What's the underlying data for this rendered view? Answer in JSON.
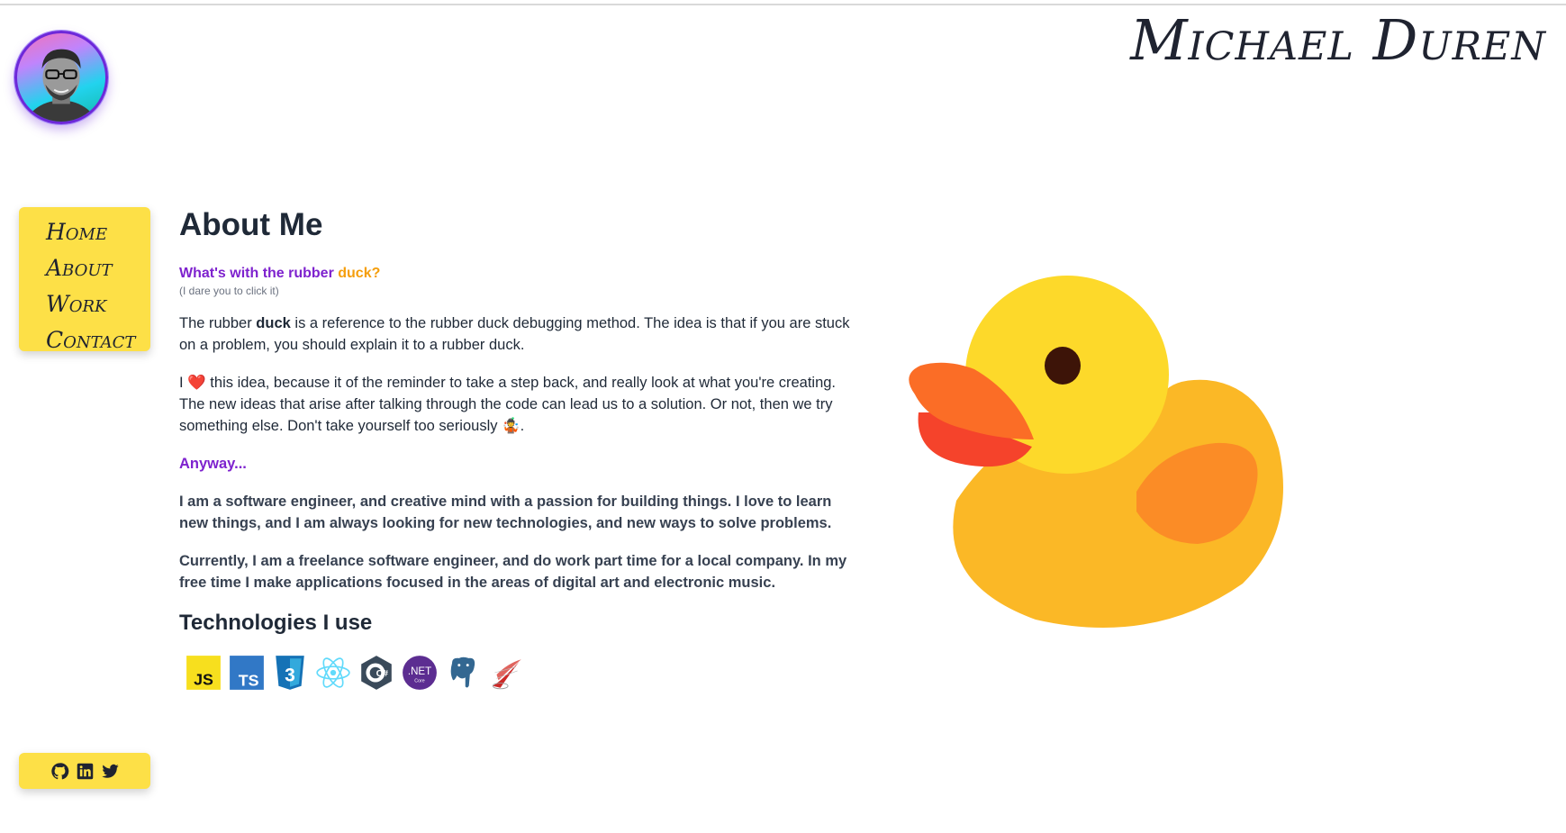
{
  "header": {
    "site_name": "Michael Duren",
    "avatar_icon": "avatar-photo-icon"
  },
  "nav": {
    "items": [
      {
        "label": "Home"
      },
      {
        "label": "About"
      },
      {
        "label": "Work"
      },
      {
        "label": "Contact"
      }
    ]
  },
  "main": {
    "title": "About Me",
    "duck_question_prefix": "What's with the rubber ",
    "duck_question_link": "duck?",
    "dare": "(I dare you to click it)",
    "para1_a": "The rubber ",
    "para1_b": "duck",
    "para1_c": " is a reference to the rubber duck debugging method. The idea is that if you are stuck on a problem, you should explain it to a rubber duck.",
    "para2_a": "I ",
    "para2_heart": "❤️",
    "para2_b": " this idea, because it of the reminder to take a step back, and really look at what you're creating. The new ideas that arise after talking through the code can lead us to a solution. Or not, then we try something else. Don't take yourself too seriously ",
    "para2_emoji": "🤹",
    "para2_end": ".",
    "anyway": "Anyway...",
    "para3": "I am a software engineer, and creative mind with a passion for building things. I love to learn new things, and I am always looking for new technologies, and new ways to solve problems.",
    "para4": "Currently, I am a freelance software engineer, and do work part time for a local company. In my free time I make applications focused in the areas of digital art and electronic music.",
    "tech_title": "Technologies I use",
    "technologies": [
      {
        "name": "javascript-icon",
        "label": "JS",
        "color": "#f7df1e"
      },
      {
        "name": "typescript-icon",
        "label": "TS",
        "color": "#3178c6"
      },
      {
        "name": "css3-icon",
        "label": "3",
        "color": "#1572b6"
      },
      {
        "name": "react-icon",
        "label": "",
        "color": "#61dafb"
      },
      {
        "name": "csharp-icon",
        "label": "C#",
        "color": "#3a4a5a"
      },
      {
        "name": "dotnet-core-icon",
        "label": ".NET",
        "sub": "Core",
        "color": "#5c2d91"
      },
      {
        "name": "postgresql-icon",
        "label": "",
        "color": "#336791"
      },
      {
        "name": "sql-server-icon",
        "label": "",
        "color": "#cc2927"
      }
    ]
  },
  "social": {
    "items": [
      {
        "name": "github-icon"
      },
      {
        "name": "linkedin-icon"
      },
      {
        "name": "twitter-icon"
      }
    ]
  },
  "colors": {
    "accent_yellow": "#fde047",
    "purple": "#7e22ce",
    "orange": "#f59e0b",
    "duck_body": "#fbb826",
    "duck_head": "#fdd92a",
    "duck_beak": "#fb6d26"
  }
}
